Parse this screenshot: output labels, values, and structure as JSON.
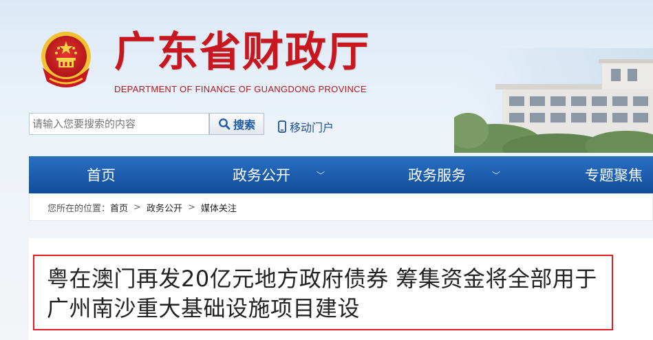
{
  "header": {
    "site_title": "广东省财政厅",
    "site_subtitle": "DEPARTMENT OF FINANCE OF GUANGDONG PROVINCE"
  },
  "search": {
    "placeholder": "请输入您要搜索的内容",
    "button_label": "搜索",
    "button_icon": "search-icon"
  },
  "mobile": {
    "label": "移动门户",
    "icon": "phone-icon"
  },
  "nav": {
    "items": [
      {
        "label": "首页"
      },
      {
        "label": "政务公开",
        "chevron": "﹀"
      },
      {
        "label": "政务服务",
        "chevron": "﹀"
      },
      {
        "label": "专题聚焦"
      }
    ]
  },
  "breadcrumb": {
    "prefix": "您所在的位置：",
    "items": [
      "首页",
      "政务公开",
      "媒体关注"
    ],
    "separator": ">"
  },
  "article": {
    "title": "粤在澳门再发20亿元地方政府债券 筹集资金将全部用于广州南沙重大基础设施项目建设"
  },
  "colors": {
    "brand_red": "#c8171e",
    "nav_blue": "#1c5cac",
    "highlight_red": "#e01c22"
  }
}
